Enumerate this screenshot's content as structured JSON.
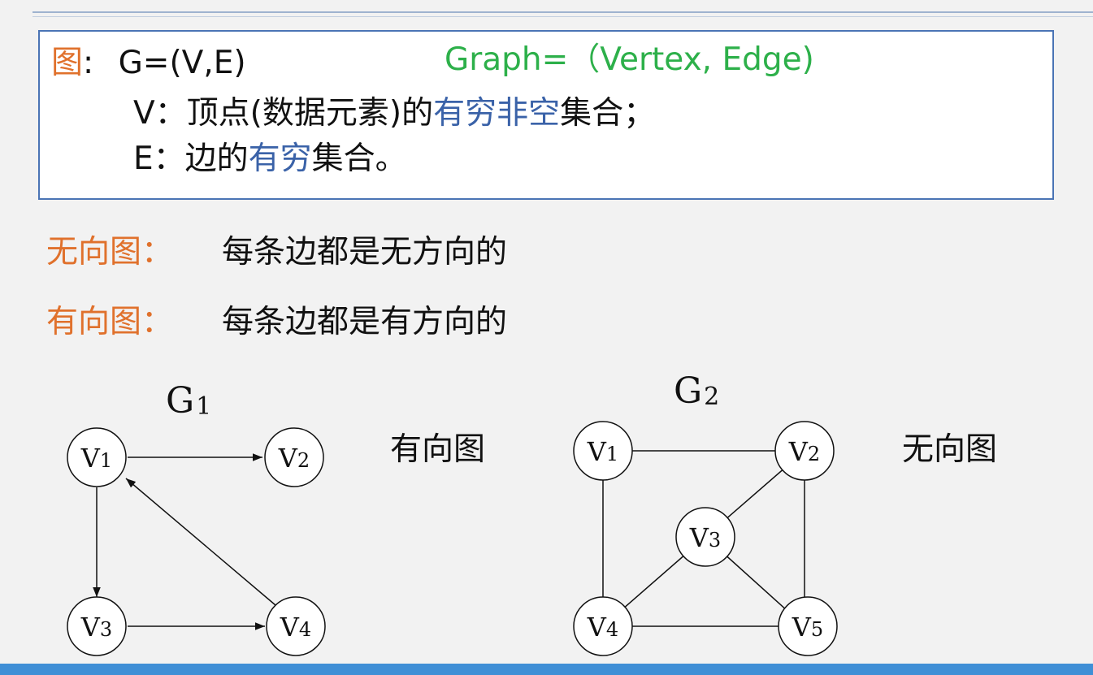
{
  "definition": {
    "line1_label": "图",
    "line1_colon": ":",
    "line1_formula": "G=(V,E)",
    "line1_english": "Graph=（Vertex, Edge)",
    "line2_prefix": "V：顶点(数据元素)的",
    "line2_highlight": "有穷非空",
    "line2_suffix": "集合；",
    "line3_prefix": "E：边的",
    "line3_highlight": "有穷",
    "line3_suffix": "集合。"
  },
  "types": [
    {
      "label": "无向图：",
      "desc": "每条边都是无方向的"
    },
    {
      "label": "有向图：",
      "desc": "每条边都是有方向的"
    }
  ],
  "graphs": [
    {
      "title": "G",
      "title_sub": "1",
      "type_label": "有向图",
      "vertices": [
        {
          "name": "V",
          "sub": "1"
        },
        {
          "name": "V",
          "sub": "2"
        },
        {
          "name": "V",
          "sub": "3"
        },
        {
          "name": "V",
          "sub": "4"
        }
      ],
      "edges": [
        [
          "V1",
          "V2"
        ],
        [
          "V1",
          "V3"
        ],
        [
          "V3",
          "V4"
        ],
        [
          "V4",
          "V1"
        ]
      ]
    },
    {
      "title": "G",
      "title_sub": "2",
      "type_label": "无向图",
      "vertices": [
        {
          "name": "V",
          "sub": "1"
        },
        {
          "name": "V",
          "sub": "2"
        },
        {
          "name": "V",
          "sub": "3"
        },
        {
          "name": "V",
          "sub": "4"
        },
        {
          "name": "V",
          "sub": "5"
        }
      ],
      "edges": [
        [
          "V1",
          "V2"
        ],
        [
          "V1",
          "V4"
        ],
        [
          "V2",
          "V3"
        ],
        [
          "V2",
          "V5"
        ],
        [
          "V3",
          "V4"
        ],
        [
          "V3",
          "V5"
        ],
        [
          "V4",
          "V5"
        ]
      ]
    }
  ]
}
